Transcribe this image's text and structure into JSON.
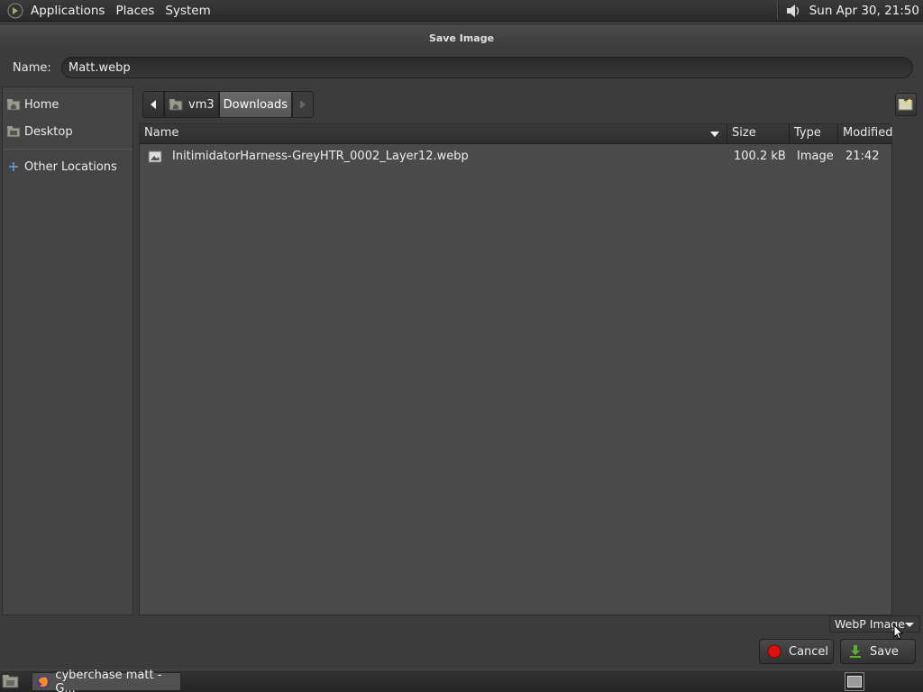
{
  "top_panel": {
    "menus": [
      "Applications",
      "Places",
      "System"
    ],
    "clock": "Sun Apr 30, 21:50",
    "icons": {
      "logo": "gnome-foot-icon",
      "volume": "speaker-icon"
    }
  },
  "dialog": {
    "title": "Save Image",
    "name_label": "Name:",
    "name_value": "Matt.webp"
  },
  "sidebar": {
    "items": [
      {
        "label": "Home",
        "icon": "home-folder-icon"
      },
      {
        "label": "Desktop",
        "icon": "desktop-folder-icon"
      },
      {
        "label": "Other Locations",
        "icon": "plus-icon"
      }
    ]
  },
  "pathbar": {
    "segments": [
      "vm3",
      "Downloads"
    ],
    "active": "Downloads"
  },
  "filelist": {
    "columns": [
      "Name",
      "Size",
      "Type",
      "Modified"
    ],
    "rows": [
      {
        "name": "InitimidatorHarness-GreyHTR_0002_Layer12.webp",
        "size": "100.2 kB",
        "type": "Image",
        "modified": "21:42"
      }
    ]
  },
  "filter": {
    "selected": "WebP Image"
  },
  "buttons": {
    "cancel": "Cancel",
    "save": "Save"
  },
  "taskbar": {
    "task_label": "cyberchase matt - G..."
  },
  "colors": {
    "background": "#3c3c3c",
    "list_bg": "#4a4a4a",
    "cancel_red": "#e01010",
    "save_green": "#5fae2e"
  }
}
